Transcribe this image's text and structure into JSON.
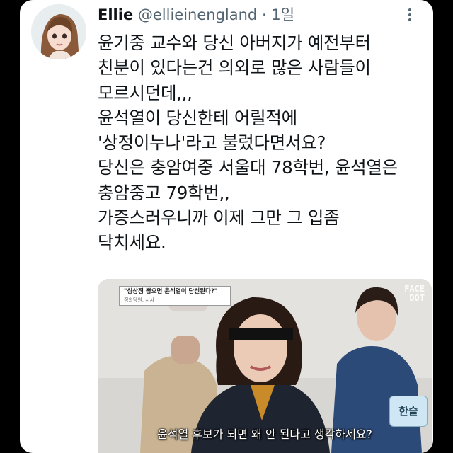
{
  "tweet": {
    "display_name": "Ellie",
    "handle": "@ellieinengland",
    "separator": "·",
    "time": "1일",
    "more_icon": "more-horizontal-icon",
    "lines": [
      "윤기중 교수와 당신 아버지가 예전부터",
      "친분이 있다는건 의외로 많은 사람들이",
      "모르시던데,,,",
      "윤석열이 당신한테 어릴적에",
      "'상정이누나'라고 불렀다면서요?",
      "당신은 충암여중 서울대 78학번, 윤석열은",
      "충암중고 79학번,,",
      "가증스러우니까 이제 그만 그 입좀",
      "닥치세요."
    ]
  },
  "media": {
    "top_caption": "\"심상정 뽑으면 윤석열이 당선된다?\"",
    "top_caption_sub": "정의당원, 시사",
    "watermark_line1": "FACE",
    "watermark_line2": "DOT",
    "name_tag": "한슬",
    "subtitle": "윤석열 후보가 되면 왜 안 된다고 생각하세요?"
  },
  "colors": {
    "background": "#000000",
    "card": "#ffffff",
    "text": "#0f1419",
    "muted": "#536471"
  }
}
